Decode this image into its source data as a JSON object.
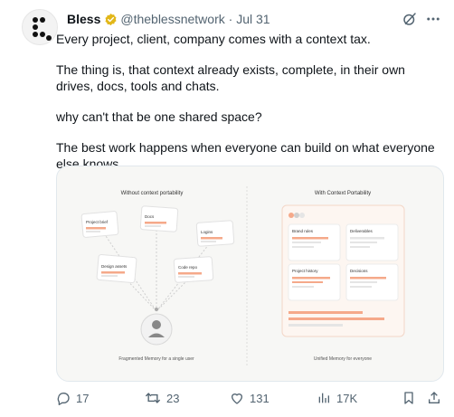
{
  "tweet": {
    "display_name": "Bless",
    "handle": "@theblessnetwork",
    "separator": "·",
    "date": "Jul 31",
    "paragraphs": [
      "Every project, client, company comes with a context tax.",
      "The thing is, that context already exists, complete, in their own drives, docs, tools and chats.",
      "why can't that be one shared space?",
      "The best work happens when everyone can build on what everyone else knows."
    ]
  },
  "illustration": {
    "left_title": "Without context portability",
    "right_title": "With Context Portability",
    "left_cards": [
      "Project brief",
      "Docs",
      "Logins",
      "Design assets",
      "Code repo"
    ],
    "left_caption": "Fragmented Memory for a single user",
    "right_cards": [
      "Brand rules",
      "Deliverables",
      "Project history",
      "Decisions"
    ],
    "right_caption": "Unified Memory for everyone",
    "accent_color": "#f5a98a"
  },
  "actions": {
    "replies": "17",
    "reposts": "23",
    "likes": "131",
    "views": "17K"
  },
  "colors": {
    "text": "#0f1419",
    "muted": "#536471",
    "verified": "#e2b719"
  }
}
